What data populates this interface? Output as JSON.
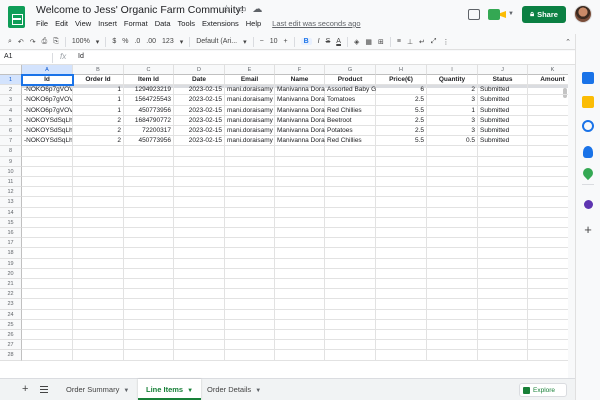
{
  "window": {
    "title": "Welcome to Jess' Organic Farm Community!",
    "menu": [
      "File",
      "Edit",
      "View",
      "Insert",
      "Format",
      "Data",
      "Tools",
      "Extensions",
      "Help"
    ],
    "last_edit": "Last edit was seconds ago",
    "share_label": "Share"
  },
  "toolbar": {
    "zoom": "100%",
    "currency": "$",
    "percent": "%",
    "dec_decrease": ".0",
    "dec_increase": ".00",
    "more_formats": "123",
    "font": "Default (Ari...",
    "font_size": "10",
    "bold": "B",
    "italic": "I",
    "strike": "S",
    "text_color": "A"
  },
  "formula_bar": {
    "cell_ref": "A1",
    "fx": "fx",
    "value": "Id"
  },
  "sheet": {
    "column_letters": [
      "A",
      "B",
      "C",
      "D",
      "E",
      "F",
      "G",
      "H",
      "I",
      "J",
      "K"
    ],
    "row_count": 28,
    "headers": [
      "Id",
      "Order Id",
      "Item Id",
      "Date",
      "Email",
      "Name",
      "Product",
      "Price(€)",
      "Quantity",
      "Status",
      "Amount"
    ],
    "rows": [
      [
        "-NOKO6p7gVOV",
        "1",
        "1294923219",
        "2023-02-15",
        "mani.doraisamy",
        "Manivanna Dora",
        "Assorted Baby G",
        "6",
        "2",
        "Submitted",
        ""
      ],
      [
        "-NOKO6p7gVOV",
        "1",
        "1564725543",
        "2023-02-15",
        "mani.doraisamy",
        "Manivanna Dora",
        "Tomatoes",
        "2.5",
        "3",
        "Submitted",
        ""
      ],
      [
        "-NOKO6p7gVOV",
        "1",
        "450773956",
        "2023-02-15",
        "mani.doraisamy",
        "Manivanna Dora",
        "Red Chillies",
        "5.5",
        "1",
        "Submitted",
        ""
      ],
      [
        "-NOKOYSdSqLh",
        "2",
        "1684790772",
        "2023-02-15",
        "mani.doraisamy",
        "Manivanna Dora",
        "Beetroot",
        "2.5",
        "3",
        "Submitted",
        ""
      ],
      [
        "-NOKOYSdSqLh",
        "2",
        "72200317",
        "2023-02-15",
        "mani.doraisamy",
        "Manivanna Dora",
        "Potatoes",
        "2.5",
        "3",
        "Submitted",
        ""
      ],
      [
        "-NOKOYSdSqLh",
        "2",
        "450773956",
        "2023-02-15",
        "mani.doraisamy",
        "Manivanna Dora",
        "Red Chillies",
        "5.5",
        "0.5",
        "Submitted",
        "2"
      ]
    ]
  },
  "tabs": [
    {
      "label": "Order Summary",
      "active": false
    },
    {
      "label": "Line Items",
      "active": true
    },
    {
      "label": "Order Details",
      "active": false
    }
  ],
  "explore_label": "Explore",
  "colors": {
    "accent": "#1a73e8",
    "share": "#0b8043",
    "active_tab": "#188038"
  }
}
